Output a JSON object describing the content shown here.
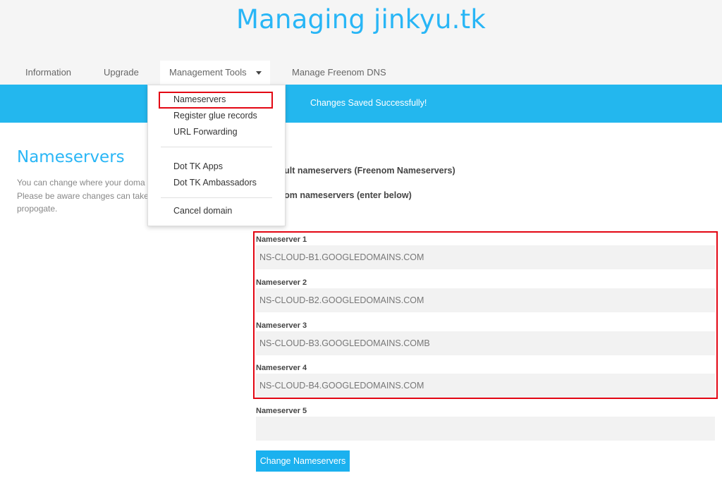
{
  "header": {
    "title": "Managing jinkyu.tk"
  },
  "nav": {
    "tabs": [
      {
        "label": "Information"
      },
      {
        "label": "Upgrade"
      },
      {
        "label": "Management Tools"
      },
      {
        "label": "Manage Freenom DNS"
      }
    ]
  },
  "banner": {
    "message": "Changes Saved Successfully!"
  },
  "dropdown": {
    "items": [
      {
        "label": "Nameservers"
      },
      {
        "label": "Register glue records"
      },
      {
        "label": "URL Forwarding"
      },
      {
        "label": "Dot TK Apps"
      },
      {
        "label": "Dot TK Ambassadors"
      },
      {
        "label": "Cancel domain"
      }
    ]
  },
  "section": {
    "title": "Nameservers",
    "description": [
      "You can change where your doma",
      "Please be aware changes can take",
      "propogate."
    ]
  },
  "options": {
    "default_label": "e default nameservers (Freenom Nameservers)",
    "custom_label": "e custom nameservers (enter below)"
  },
  "nameservers": [
    {
      "label": "Nameserver 1",
      "value": "NS-CLOUD-B1.GOOGLEDOMAINS.COM"
    },
    {
      "label": "Nameserver 2",
      "value": "NS-CLOUD-B2.GOOGLEDOMAINS.COM"
    },
    {
      "label": "Nameserver 3",
      "value": "NS-CLOUD-B3.GOOGLEDOMAINS.COMB"
    },
    {
      "label": "Nameserver 4",
      "value": "NS-CLOUD-B4.GOOGLEDOMAINS.COM"
    },
    {
      "label": "Nameserver 5",
      "value": ""
    }
  ],
  "actions": {
    "change_label": "Change Nameservers"
  },
  "colors": {
    "accent": "#29b6f6",
    "banner": "#23b7ee",
    "button": "#1bb1ef",
    "highlight": "#e30613"
  }
}
